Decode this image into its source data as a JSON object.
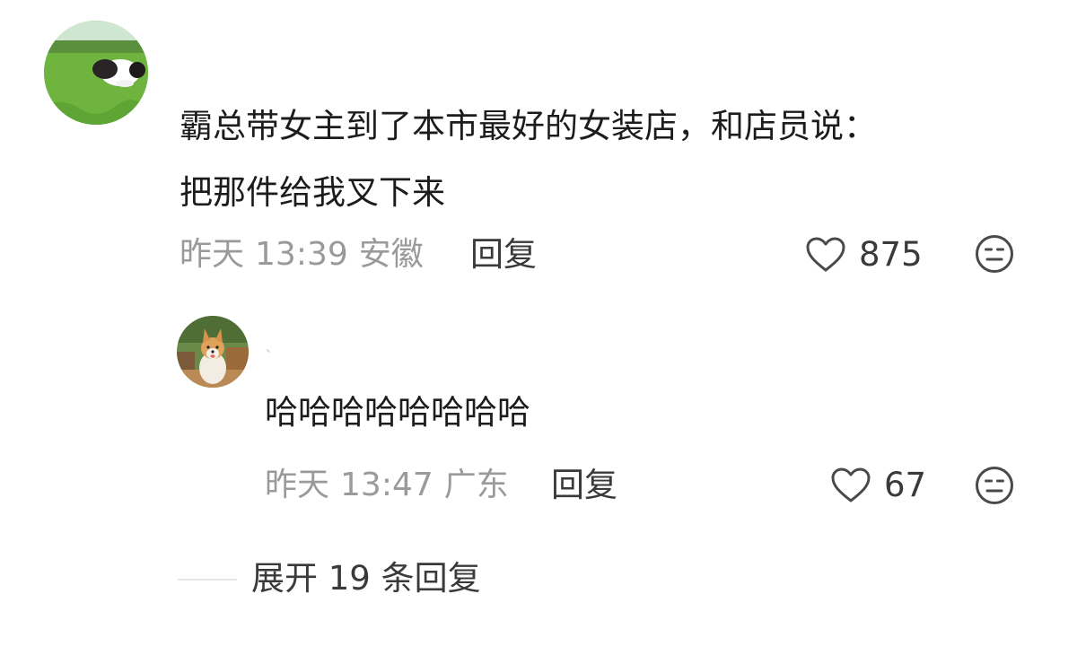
{
  "comment": {
    "avatar": "dog-on-grass-avatar",
    "text_line1": "霸总带女主到了本市最好的女装店，和店员说：",
    "text_line2": "把那件给我叉下来",
    "date": "昨天",
    "time": "13:39",
    "location": "安徽",
    "reply_label": "回复",
    "like_count": "875",
    "like_icon": "heart-outline-icon",
    "dislike_icon": "meh-face-icon"
  },
  "reply": {
    "avatar": "corgi-avatar",
    "name_mark": "、",
    "text": "哈哈哈哈哈哈哈哈",
    "date": "昨天",
    "time": "13:47",
    "location": "广东",
    "reply_label": "回复",
    "like_count": "67",
    "like_icon": "heart-outline-icon",
    "dislike_icon": "meh-face-icon"
  },
  "expand": {
    "label": "展开 19 条回复"
  },
  "colors": {
    "text_primary": "#1c1c1c",
    "text_secondary": "#9a9a9a",
    "action": "#3a3a3a"
  }
}
